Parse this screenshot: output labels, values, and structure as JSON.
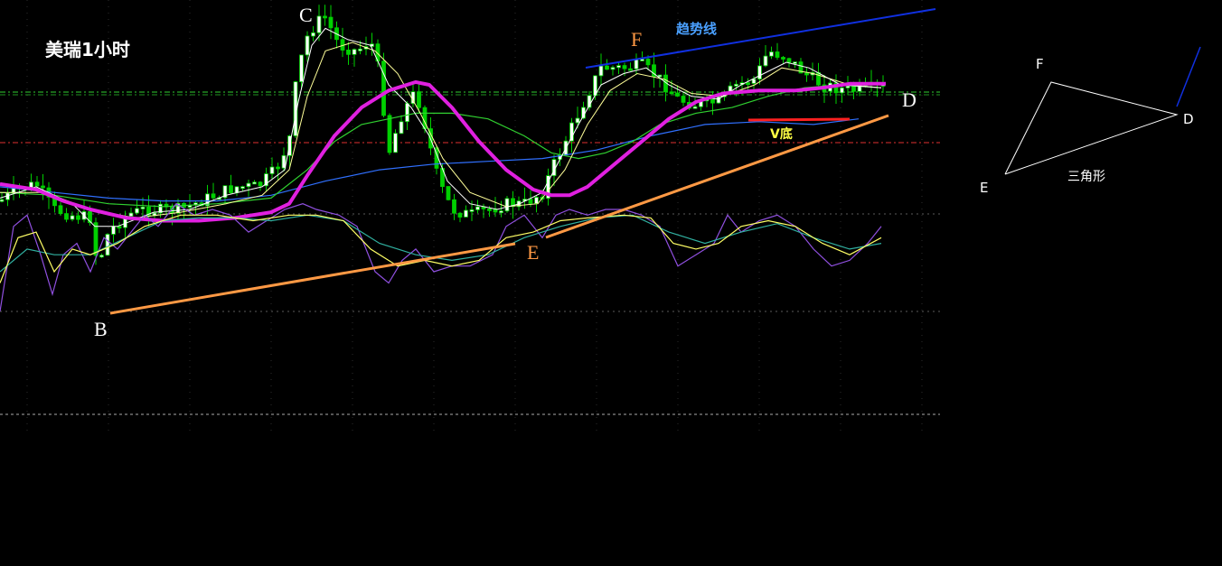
{
  "chart_data": {
    "type": "candlestick",
    "title": "美瑞1小时",
    "point_labels": {
      "B": "B",
      "C": "C",
      "D": "D",
      "E": "E",
      "F": "F"
    },
    "annotations": {
      "trendline": "趋势线",
      "v_bottom": "V底",
      "triangle": "三角形"
    },
    "triangle_labels": {
      "F": "F",
      "D": "D",
      "E": "E"
    },
    "colors": {
      "background": "#000000",
      "candle": "#00d000",
      "candle_up_body": "#ffffff",
      "ma_main": "#e020e0",
      "ma_short_white": "#ffffff",
      "ma_short_yellow": "#ffff99",
      "ma_mid_green": "#30d030",
      "ma_long_blue": "#3070ff",
      "support_line": "#ff9944",
      "trend_line": "#1030e0",
      "v_bottom_line": "#ff2020",
      "green_level": "#30d030",
      "red_level": "#e03030",
      "osc_purple": "#9050e0",
      "osc_yellow": "#ffff66",
      "osc_cyan": "#30b0a0",
      "grid": "#808080"
    },
    "price_path": [
      [
        0,
        0.355
      ],
      [
        20,
        0.335
      ],
      [
        40,
        0.325
      ],
      [
        60,
        0.37
      ],
      [
        80,
        0.38
      ],
      [
        100,
        0.385
      ],
      [
        108,
        0.47
      ],
      [
        120,
        0.41
      ],
      [
        140,
        0.38
      ],
      [
        160,
        0.37
      ],
      [
        185,
        0.372
      ],
      [
        200,
        0.37
      ],
      [
        230,
        0.35
      ],
      [
        260,
        0.33
      ],
      [
        285,
        0.33
      ],
      [
        305,
        0.3
      ],
      [
        320,
        0.25
      ],
      [
        328,
        0.14
      ],
      [
        338,
        0.07
      ],
      [
        350,
        0.04
      ],
      [
        360,
        0.03
      ],
      [
        375,
        0.08
      ],
      [
        395,
        0.09
      ],
      [
        410,
        0.07
      ],
      [
        420,
        0.13
      ],
      [
        430,
        0.27
      ],
      [
        445,
        0.2
      ],
      [
        460,
        0.16
      ],
      [
        470,
        0.22
      ],
      [
        485,
        0.32
      ],
      [
        500,
        0.37
      ],
      [
        520,
        0.38
      ],
      [
        540,
        0.37
      ],
      [
        560,
        0.36
      ],
      [
        580,
        0.36
      ],
      [
        600,
        0.34
      ],
      [
        610,
        0.3
      ],
      [
        625,
        0.25
      ],
      [
        640,
        0.2
      ],
      [
        655,
        0.15
      ],
      [
        665,
        0.12
      ],
      [
        690,
        0.12
      ],
      [
        710,
        0.115
      ],
      [
        730,
        0.14
      ],
      [
        750,
        0.175
      ],
      [
        770,
        0.185
      ],
      [
        795,
        0.18
      ],
      [
        815,
        0.15
      ],
      [
        835,
        0.14
      ],
      [
        850,
        0.09
      ],
      [
        870,
        0.1
      ],
      [
        890,
        0.13
      ],
      [
        910,
        0.15
      ],
      [
        940,
        0.16
      ],
      [
        975,
        0.155
      ]
    ],
    "ma_main": [
      [
        0,
        0.325
      ],
      [
        40,
        0.335
      ],
      [
        70,
        0.355
      ],
      [
        100,
        0.37
      ],
      [
        140,
        0.385
      ],
      [
        180,
        0.39
      ],
      [
        220,
        0.39
      ],
      [
        260,
        0.385
      ],
      [
        300,
        0.375
      ],
      [
        320,
        0.36
      ],
      [
        340,
        0.31
      ],
      [
        370,
        0.24
      ],
      [
        400,
        0.19
      ],
      [
        430,
        0.16
      ],
      [
        460,
        0.145
      ],
      [
        475,
        0.15
      ],
      [
        500,
        0.19
      ],
      [
        530,
        0.25
      ],
      [
        560,
        0.3
      ],
      [
        590,
        0.335
      ],
      [
        610,
        0.345
      ],
      [
        630,
        0.345
      ],
      [
        650,
        0.33
      ],
      [
        680,
        0.29
      ],
      [
        710,
        0.25
      ],
      [
        740,
        0.21
      ],
      [
        770,
        0.18
      ],
      [
        800,
        0.165
      ],
      [
        840,
        0.16
      ],
      [
        880,
        0.16
      ],
      [
        910,
        0.155
      ],
      [
        940,
        0.148
      ],
      [
        960,
        0.148
      ],
      [
        980,
        0.148
      ]
    ],
    "ma_white": [
      [
        0,
        0.35
      ],
      [
        40,
        0.33
      ],
      [
        80,
        0.36
      ],
      [
        105,
        0.4
      ],
      [
        130,
        0.4
      ],
      [
        170,
        0.375
      ],
      [
        210,
        0.37
      ],
      [
        250,
        0.345
      ],
      [
        290,
        0.33
      ],
      [
        315,
        0.3
      ],
      [
        330,
        0.18
      ],
      [
        345,
        0.08
      ],
      [
        360,
        0.05
      ],
      [
        385,
        0.07
      ],
      [
        410,
        0.08
      ],
      [
        430,
        0.15
      ],
      [
        455,
        0.19
      ],
      [
        475,
        0.24
      ],
      [
        495,
        0.32
      ],
      [
        520,
        0.36
      ],
      [
        550,
        0.37
      ],
      [
        575,
        0.36
      ],
      [
        600,
        0.34
      ],
      [
        620,
        0.28
      ],
      [
        640,
        0.22
      ],
      [
        665,
        0.15
      ],
      [
        690,
        0.13
      ],
      [
        715,
        0.12
      ],
      [
        740,
        0.15
      ],
      [
        765,
        0.17
      ],
      [
        795,
        0.175
      ],
      [
        820,
        0.15
      ],
      [
        845,
        0.13
      ],
      [
        870,
        0.11
      ],
      [
        895,
        0.12
      ],
      [
        930,
        0.15
      ],
      [
        975,
        0.155
      ]
    ],
    "ma_yellow": [
      [
        0,
        0.34
      ],
      [
        50,
        0.34
      ],
      [
        100,
        0.37
      ],
      [
        150,
        0.385
      ],
      [
        200,
        0.375
      ],
      [
        250,
        0.36
      ],
      [
        290,
        0.345
      ],
      [
        320,
        0.3
      ],
      [
        340,
        0.17
      ],
      [
        360,
        0.09
      ],
      [
        390,
        0.075
      ],
      [
        415,
        0.09
      ],
      [
        440,
        0.13
      ],
      [
        465,
        0.2
      ],
      [
        490,
        0.28
      ],
      [
        520,
        0.34
      ],
      [
        560,
        0.365
      ],
      [
        595,
        0.36
      ],
      [
        625,
        0.3
      ],
      [
        650,
        0.22
      ],
      [
        675,
        0.16
      ],
      [
        705,
        0.13
      ],
      [
        735,
        0.14
      ],
      [
        765,
        0.165
      ],
      [
        800,
        0.17
      ],
      [
        835,
        0.15
      ],
      [
        865,
        0.12
      ],
      [
        900,
        0.13
      ],
      [
        940,
        0.15
      ],
      [
        975,
        0.155
      ]
    ],
    "ma_green": [
      [
        0,
        0.34
      ],
      [
        60,
        0.345
      ],
      [
        120,
        0.36
      ],
      [
        180,
        0.365
      ],
      [
        240,
        0.36
      ],
      [
        300,
        0.35
      ],
      [
        340,
        0.3
      ],
      [
        370,
        0.25
      ],
      [
        400,
        0.22
      ],
      [
        430,
        0.21
      ],
      [
        460,
        0.2
      ],
      [
        500,
        0.2
      ],
      [
        540,
        0.21
      ],
      [
        580,
        0.24
      ],
      [
        610,
        0.27
      ],
      [
        640,
        0.28
      ],
      [
        670,
        0.27
      ],
      [
        700,
        0.25
      ],
      [
        730,
        0.22
      ],
      [
        770,
        0.2
      ],
      [
        810,
        0.19
      ],
      [
        850,
        0.17
      ],
      [
        890,
        0.155
      ],
      [
        930,
        0.15
      ],
      [
        975,
        0.155
      ]
    ],
    "ma_blue": [
      [
        0,
        0.33
      ],
      [
        60,
        0.34
      ],
      [
        120,
        0.35
      ],
      [
        180,
        0.355
      ],
      [
        240,
        0.355
      ],
      [
        300,
        0.345
      ],
      [
        360,
        0.32
      ],
      [
        420,
        0.3
      ],
      [
        480,
        0.29
      ],
      [
        540,
        0.285
      ],
      [
        600,
        0.28
      ],
      [
        660,
        0.265
      ],
      [
        720,
        0.24
      ],
      [
        780,
        0.22
      ],
      [
        840,
        0.215
      ],
      [
        900,
        0.22
      ],
      [
        950,
        0.21
      ]
    ],
    "osc_purple": [
      [
        0,
        0.55
      ],
      [
        15,
        0.4
      ],
      [
        30,
        0.38
      ],
      [
        45,
        0.45
      ],
      [
        58,
        0.52
      ],
      [
        70,
        0.45
      ],
      [
        85,
        0.43
      ],
      [
        100,
        0.48
      ],
      [
        115,
        0.42
      ],
      [
        130,
        0.44
      ],
      [
        145,
        0.41
      ],
      [
        160,
        0.38
      ],
      [
        175,
        0.4
      ],
      [
        195,
        0.36
      ],
      [
        215,
        0.38
      ],
      [
        235,
        0.37
      ],
      [
        255,
        0.38
      ],
      [
        275,
        0.41
      ],
      [
        295,
        0.39
      ],
      [
        315,
        0.37
      ],
      [
        335,
        0.36
      ],
      [
        350,
        0.37
      ],
      [
        375,
        0.38
      ],
      [
        395,
        0.4
      ],
      [
        415,
        0.48
      ],
      [
        430,
        0.5
      ],
      [
        445,
        0.46
      ],
      [
        460,
        0.44
      ],
      [
        480,
        0.48
      ],
      [
        500,
        0.47
      ],
      [
        520,
        0.47
      ],
      [
        545,
        0.45
      ],
      [
        560,
        0.4
      ],
      [
        580,
        0.38
      ],
      [
        600,
        0.42
      ],
      [
        615,
        0.38
      ],
      [
        630,
        0.37
      ],
      [
        650,
        0.38
      ],
      [
        670,
        0.37
      ],
      [
        690,
        0.37
      ],
      [
        710,
        0.38
      ],
      [
        730,
        0.4
      ],
      [
        750,
        0.47
      ],
      [
        770,
        0.45
      ],
      [
        790,
        0.43
      ],
      [
        805,
        0.38
      ],
      [
        820,
        0.41
      ],
      [
        840,
        0.39
      ],
      [
        860,
        0.38
      ],
      [
        880,
        0.4
      ],
      [
        900,
        0.44
      ],
      [
        920,
        0.47
      ],
      [
        940,
        0.46
      ],
      [
        960,
        0.43
      ],
      [
        975,
        0.4
      ]
    ],
    "osc_yellow": [
      [
        0,
        0.5
      ],
      [
        20,
        0.42
      ],
      [
        40,
        0.41
      ],
      [
        60,
        0.48
      ],
      [
        80,
        0.44
      ],
      [
        100,
        0.45
      ],
      [
        130,
        0.43
      ],
      [
        160,
        0.4
      ],
      [
        200,
        0.38
      ],
      [
        240,
        0.38
      ],
      [
        280,
        0.39
      ],
      [
        320,
        0.38
      ],
      [
        350,
        0.38
      ],
      [
        380,
        0.39
      ],
      [
        410,
        0.44
      ],
      [
        440,
        0.47
      ],
      [
        470,
        0.46
      ],
      [
        500,
        0.47
      ],
      [
        530,
        0.46
      ],
      [
        560,
        0.42
      ],
      [
        590,
        0.41
      ],
      [
        620,
        0.39
      ],
      [
        650,
        0.385
      ],
      [
        690,
        0.38
      ],
      [
        720,
        0.385
      ],
      [
        745,
        0.43
      ],
      [
        770,
        0.44
      ],
      [
        795,
        0.43
      ],
      [
        820,
        0.4
      ],
      [
        850,
        0.39
      ],
      [
        880,
        0.4
      ],
      [
        910,
        0.43
      ],
      [
        940,
        0.45
      ],
      [
        975,
        0.42
      ]
    ],
    "osc_cyan": [
      [
        0,
        0.48
      ],
      [
        30,
        0.44
      ],
      [
        60,
        0.45
      ],
      [
        100,
        0.45
      ],
      [
        140,
        0.42
      ],
      [
        180,
        0.39
      ],
      [
        220,
        0.385
      ],
      [
        260,
        0.385
      ],
      [
        300,
        0.39
      ],
      [
        340,
        0.38
      ],
      [
        380,
        0.39
      ],
      [
        420,
        0.43
      ],
      [
        460,
        0.45
      ],
      [
        500,
        0.46
      ],
      [
        540,
        0.45
      ],
      [
        580,
        0.42
      ],
      [
        620,
        0.4
      ],
      [
        660,
        0.385
      ],
      [
        700,
        0.38
      ],
      [
        740,
        0.41
      ],
      [
        780,
        0.43
      ],
      [
        820,
        0.41
      ],
      [
        860,
        0.395
      ],
      [
        900,
        0.42
      ],
      [
        940,
        0.44
      ],
      [
        975,
        0.43
      ]
    ]
  }
}
